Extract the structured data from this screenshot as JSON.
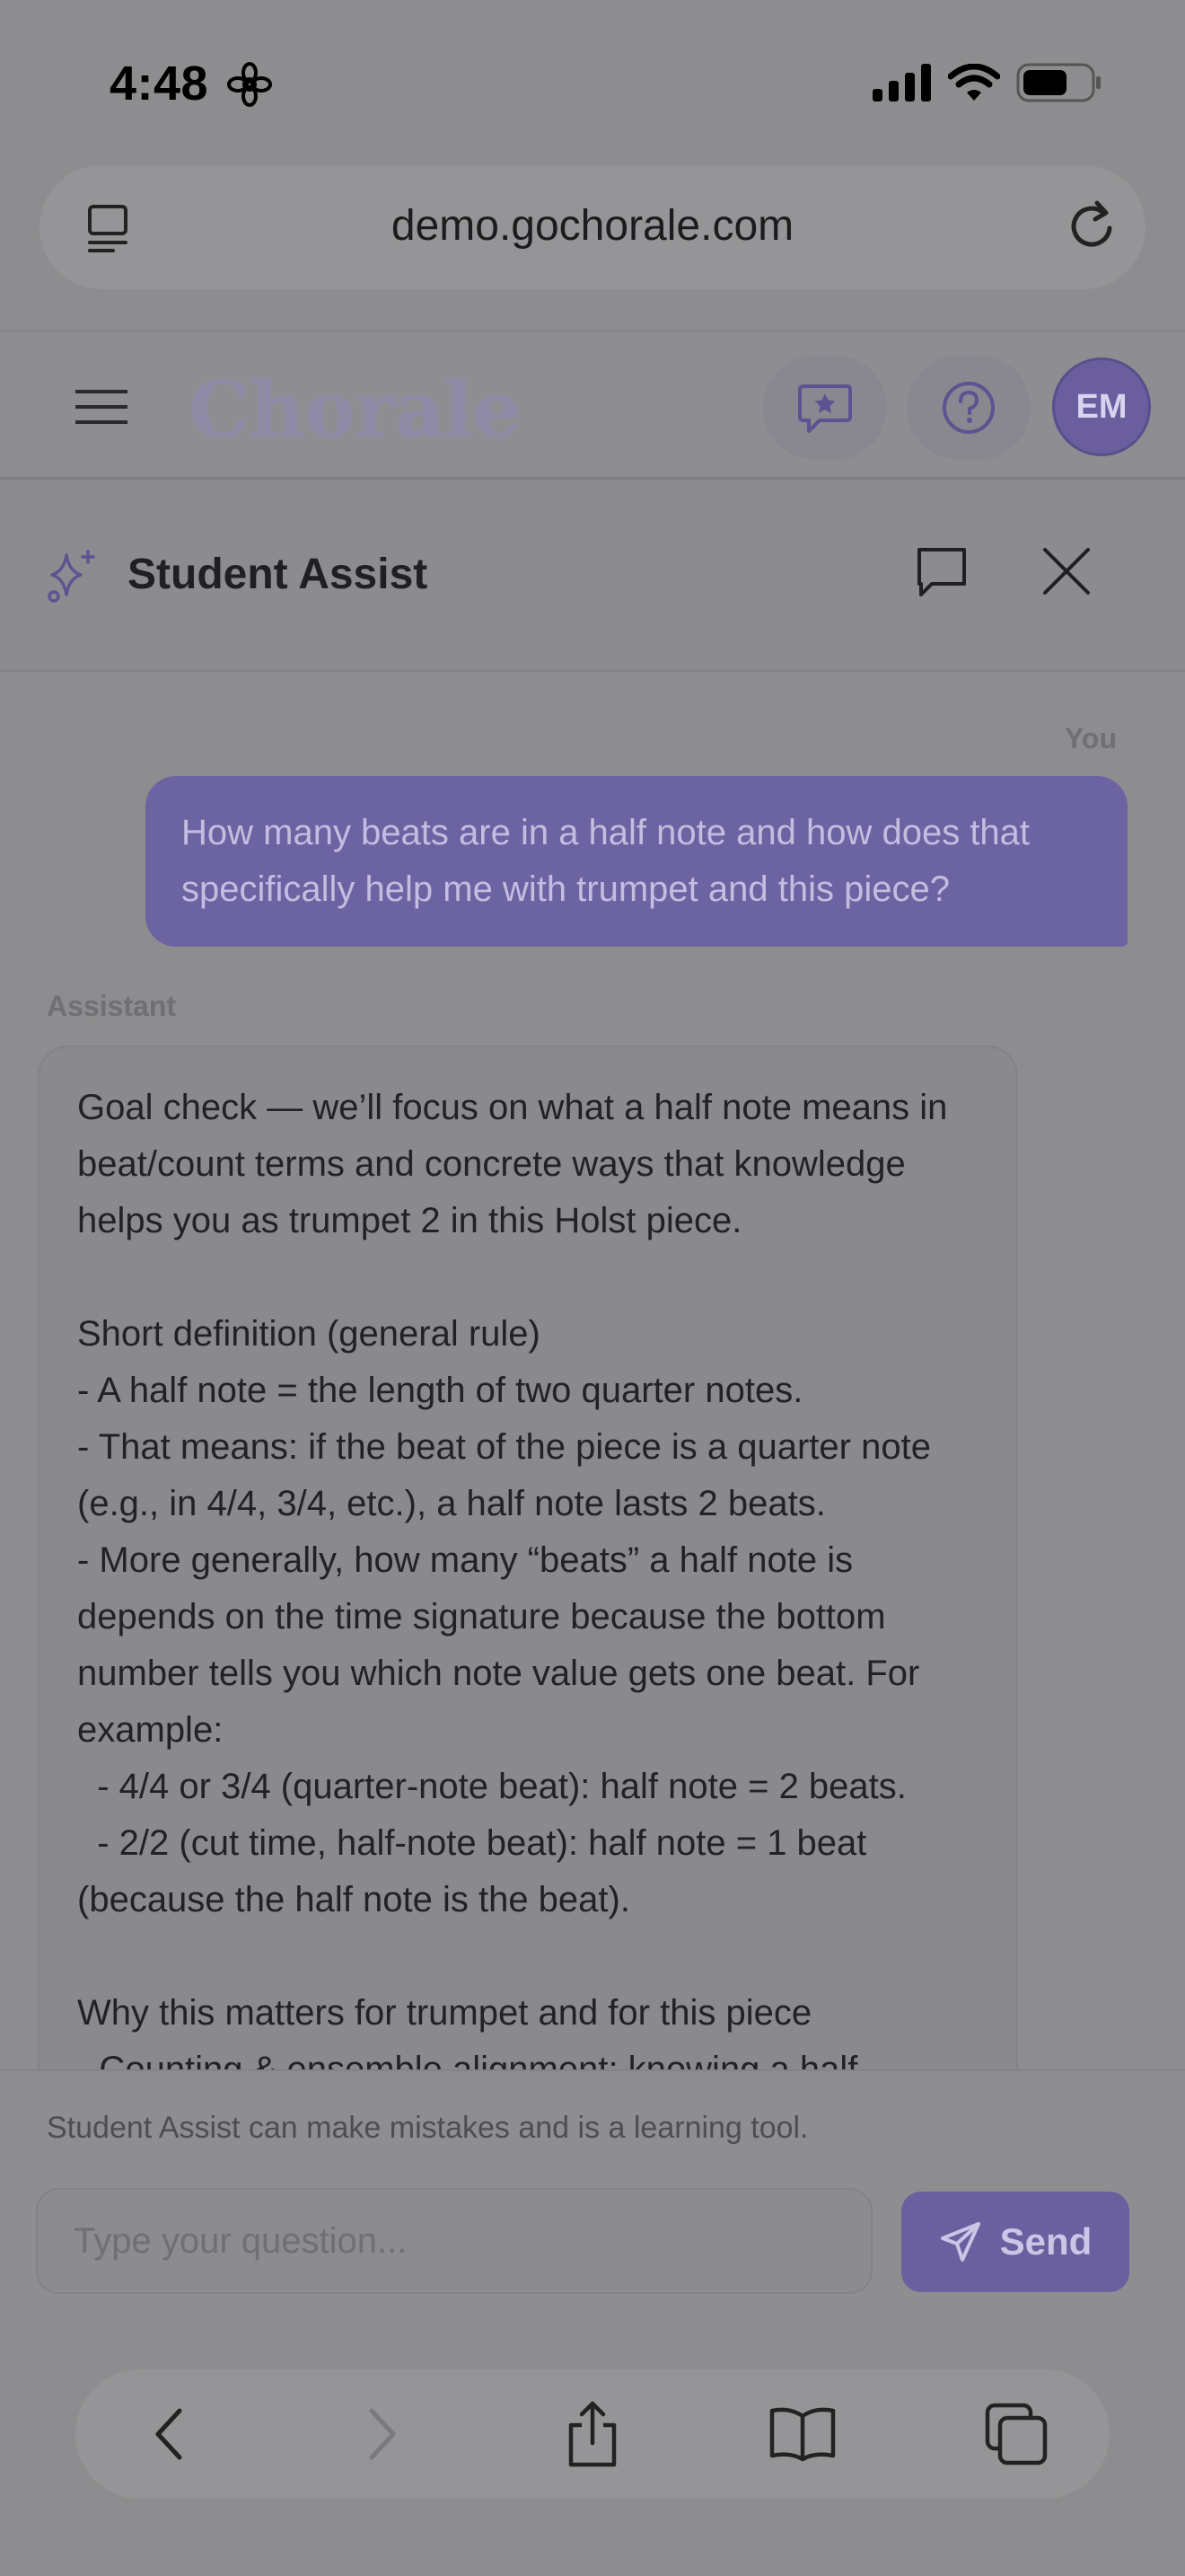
{
  "status_bar": {
    "time": "4:48"
  },
  "browser": {
    "url": "demo.gochorale.com"
  },
  "app_header": {
    "logo": "Chorale",
    "avatar_initials": "EM"
  },
  "assist_panel": {
    "title": "Student Assist"
  },
  "messages": {
    "user_label": "You",
    "user_text": "How many beats are in a half note and how does that specifically help me with trumpet and this piece?",
    "assistant_label": "Assistant",
    "assistant_text": "Goal check — we’ll focus on what a half note means in beat/count terms and concrete ways that knowledge helps you as trumpet 2 in this Holst piece.\n\nShort definition (general rule)\n- A half note = the length of two quarter notes.\n- That means: if the beat of the piece is a quarter note (e.g., in 4/4, 3/4, etc.), a half note lasts 2 beats.\n- More generally, how many “beats” a half note is depends on the time signature because the bottom number tells you which note value gets one beat. For example:\n  - 4/4 or 3/4 (quarter-note beat): half note = 2 beats.\n  - 2/2 (cut time, half-note beat): half note = 1 beat (because the half note is the beat).\n\nWhy this matters for trumpet and for this piece\n- Counting & ensemble alignment: knowing a half"
  },
  "footer": {
    "disclaimer": "Student Assist can make mistakes and is a learning tool.",
    "input_placeholder": "Type your question...",
    "send_label": "Send"
  },
  "colors": {
    "accent": "#6a609f",
    "overlay_bg": "#8d8d8f"
  }
}
